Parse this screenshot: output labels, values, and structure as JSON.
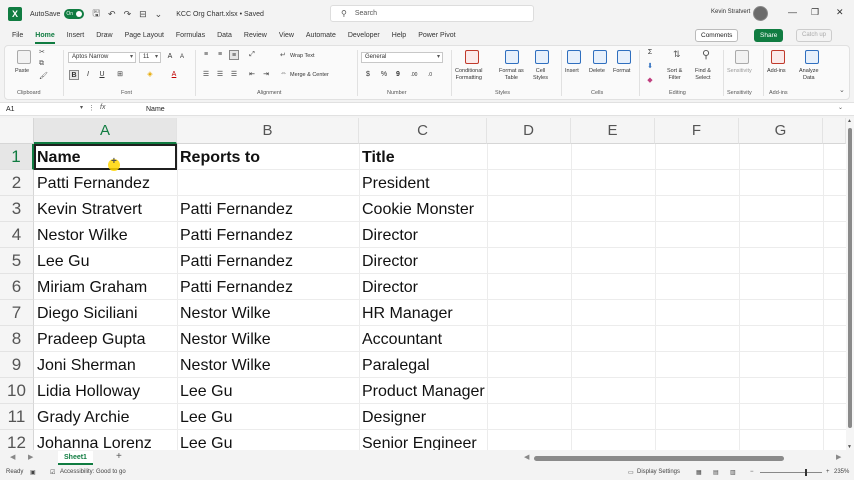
{
  "titlebar": {
    "logo": "X",
    "autosave_label": "AutoSave",
    "autosave_state": "On",
    "filename": "KCC Org Chart.xlsx • Saved",
    "search_placeholder": "Search",
    "user_name": "Kevin Stratvert"
  },
  "menu": {
    "tabs": [
      "File",
      "Home",
      "Insert",
      "Draw",
      "Page Layout",
      "Formulas",
      "Data",
      "Review",
      "View",
      "Automate",
      "Developer",
      "Help",
      "Power Pivot"
    ],
    "active": "Home",
    "comments_label": "Comments",
    "share_label": "Share",
    "catchup_label": "Catch up"
  },
  "ribbon": {
    "groups": [
      "Clipboard",
      "Font",
      "Alignment",
      "Number",
      "Styles",
      "Cells",
      "Editing",
      "Sensitivity",
      "Add-ins"
    ],
    "paste_label": "Paste",
    "font_name": "Aptos Narrow",
    "font_size": "11",
    "wrap_text": "Wrap Text",
    "merge_center": "Merge & Center",
    "number_format": "General",
    "conditional_formatting": [
      "Conditional",
      "Formatting"
    ],
    "format_as_table": [
      "Format as",
      "Table"
    ],
    "cell_styles": [
      "Cell",
      "Styles"
    ],
    "insert": "Insert",
    "delete": "Delete",
    "format": "Format",
    "sort_filter": [
      "Sort &",
      "Filter"
    ],
    "find_select": [
      "Find &",
      "Select"
    ],
    "sensitivity": "Sensitivity",
    "addins": "Add-ins",
    "analyze_data": [
      "Analyze",
      "Data"
    ]
  },
  "formula_bar": {
    "name_box": "A1",
    "fx": "fx",
    "value": "Name"
  },
  "sheet": {
    "columns": [
      "A",
      "B",
      "C",
      "D",
      "E",
      "F",
      "G"
    ],
    "rows": [
      {
        "n": "1",
        "a": "Name",
        "b": "Reports to",
        "c": "Title"
      },
      {
        "n": "2",
        "a": "Patti Fernandez",
        "b": "",
        "c": "President"
      },
      {
        "n": "3",
        "a": "Kevin Stratvert",
        "b": "Patti Fernandez",
        "c": "Cookie Monster"
      },
      {
        "n": "4",
        "a": "Nestor Wilke",
        "b": "Patti Fernandez",
        "c": "Director"
      },
      {
        "n": "5",
        "a": "Lee Gu",
        "b": "Patti Fernandez",
        "c": "Director"
      },
      {
        "n": "6",
        "a": "Miriam Graham",
        "b": "Patti Fernandez",
        "c": "Director"
      },
      {
        "n": "7",
        "a": "Diego Siciliani",
        "b": "Nestor Wilke",
        "c": "HR Manager"
      },
      {
        "n": "8",
        "a": "Pradeep Gupta",
        "b": "Nestor Wilke",
        "c": "Accountant"
      },
      {
        "n": "9",
        "a": "Joni Sherman",
        "b": "Nestor Wilke",
        "c": "Paralegal"
      },
      {
        "n": "10",
        "a": "Lidia Holloway",
        "b": "Lee Gu",
        "c": "Product Manager"
      },
      {
        "n": "11",
        "a": "Grady Archie",
        "b": "Lee Gu",
        "c": "Designer"
      },
      {
        "n": "12",
        "a": "Johanna Lorenz",
        "b": "Lee Gu",
        "c": "Senior Engineer"
      }
    ],
    "sheet_tab": "Sheet1"
  },
  "status": {
    "ready": "Ready",
    "accessibility": "Accessibility: Good to go",
    "display_settings": "Display Settings",
    "zoom": "235%"
  }
}
